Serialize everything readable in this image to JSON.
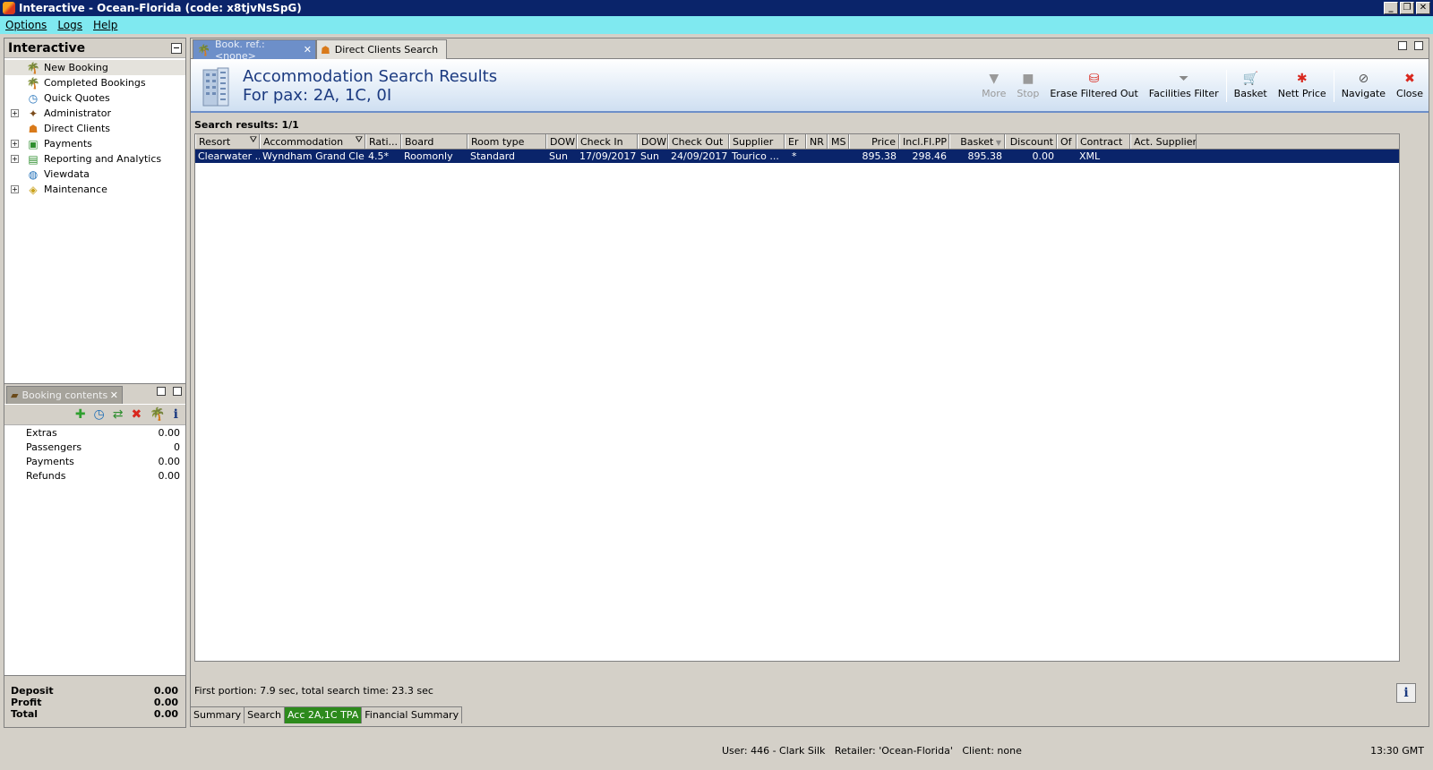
{
  "window": {
    "title": "Interactive - Ocean-Florida (code: x8tjvNsSpG)",
    "buttons": [
      "_",
      "❐",
      "✕"
    ]
  },
  "menu": [
    "Options",
    "Logs",
    "Help"
  ],
  "nav": {
    "title": "Interactive",
    "items": [
      {
        "label": "New Booking",
        "icon": "palm-tree-icon",
        "expandable": false,
        "selected": true
      },
      {
        "label": "Completed Bookings",
        "icon": "palm-tree-icon",
        "expandable": false
      },
      {
        "label": "Quick Quotes",
        "icon": "clock-icon",
        "expandable": false
      },
      {
        "label": "Administrator",
        "icon": "admin-icon",
        "expandable": true
      },
      {
        "label": "Direct Clients",
        "icon": "client-icon",
        "expandable": false
      },
      {
        "label": "Payments",
        "icon": "payments-icon",
        "expandable": true
      },
      {
        "label": "Reporting and Analytics",
        "icon": "report-icon",
        "expandable": true
      },
      {
        "label": "Viewdata",
        "icon": "globe-icon",
        "expandable": false
      },
      {
        "label": "Maintenance",
        "icon": "maintenance-icon",
        "expandable": true
      }
    ]
  },
  "booking_contents": {
    "tab_label": "Booking contents",
    "rows": [
      {
        "label": "Extras",
        "value": "0.00"
      },
      {
        "label": "Passengers",
        "value": "0"
      },
      {
        "label": "Payments",
        "value": "0.00"
      },
      {
        "label": "Refunds",
        "value": "0.00"
      }
    ],
    "footer": [
      {
        "label": "Deposit",
        "value": "0.00"
      },
      {
        "label": "Profit",
        "value": "0.00"
      },
      {
        "label": "Total",
        "value": "0.00"
      }
    ]
  },
  "tabs": {
    "active": "Book. ref.: <none>",
    "inactive": "Direct Clients Search"
  },
  "header": {
    "title": "Accommodation Search Results",
    "subtitle": "For pax: 2A, 1C, 0I"
  },
  "toolbar": {
    "more": "More",
    "stop": "Stop",
    "erase": "Erase Filtered Out",
    "facilities": "Facilities Filter",
    "basket": "Basket",
    "nett_price": "Nett Price",
    "navigate": "Navigate",
    "close": "Close"
  },
  "results": {
    "label": "Search results: 1/1",
    "columns": [
      "Resort",
      "Accommodation",
      "Rati...",
      "Board",
      "Room type",
      "DOW",
      "Check In",
      "DOW",
      "Check Out",
      "Supplier",
      "Er",
      "NR",
      "MS",
      "Price",
      "Incl.Fl.PP",
      "Basket",
      "Discount",
      "Of",
      "Contract",
      "Act. Supplier"
    ],
    "rows": [
      [
        "Clearwater ...",
        "Wyndham Grand Cle...",
        "4.5*",
        "Roomonly",
        "Standard",
        "Sun",
        "17/09/2017",
        "Sun",
        "24/09/2017",
        "Tourico ...",
        "*",
        "",
        "",
        "895.38",
        "298.46",
        "895.38",
        "0.00",
        "",
        "XML",
        ""
      ]
    ]
  },
  "status": {
    "search_time": "First portion: 7.9 sec, total search time: 23.3 sec",
    "info": "i"
  },
  "bottom_tabs": [
    "Summary",
    "Search",
    "Acc 2A,1C TPA",
    "Financial Summary"
  ],
  "statusbar": {
    "user": "User: 446 - Clark Silk   Retailer: 'Ocean-Florida'   Client: none",
    "time": "13:30 GMT"
  },
  "colors": {
    "title_bar": "#0a246a",
    "menu_bar": "#7fe9f0",
    "selection": "#0a246a",
    "active_bottom_tab": "#2d8a1c",
    "header_text": "#1b3a80"
  }
}
